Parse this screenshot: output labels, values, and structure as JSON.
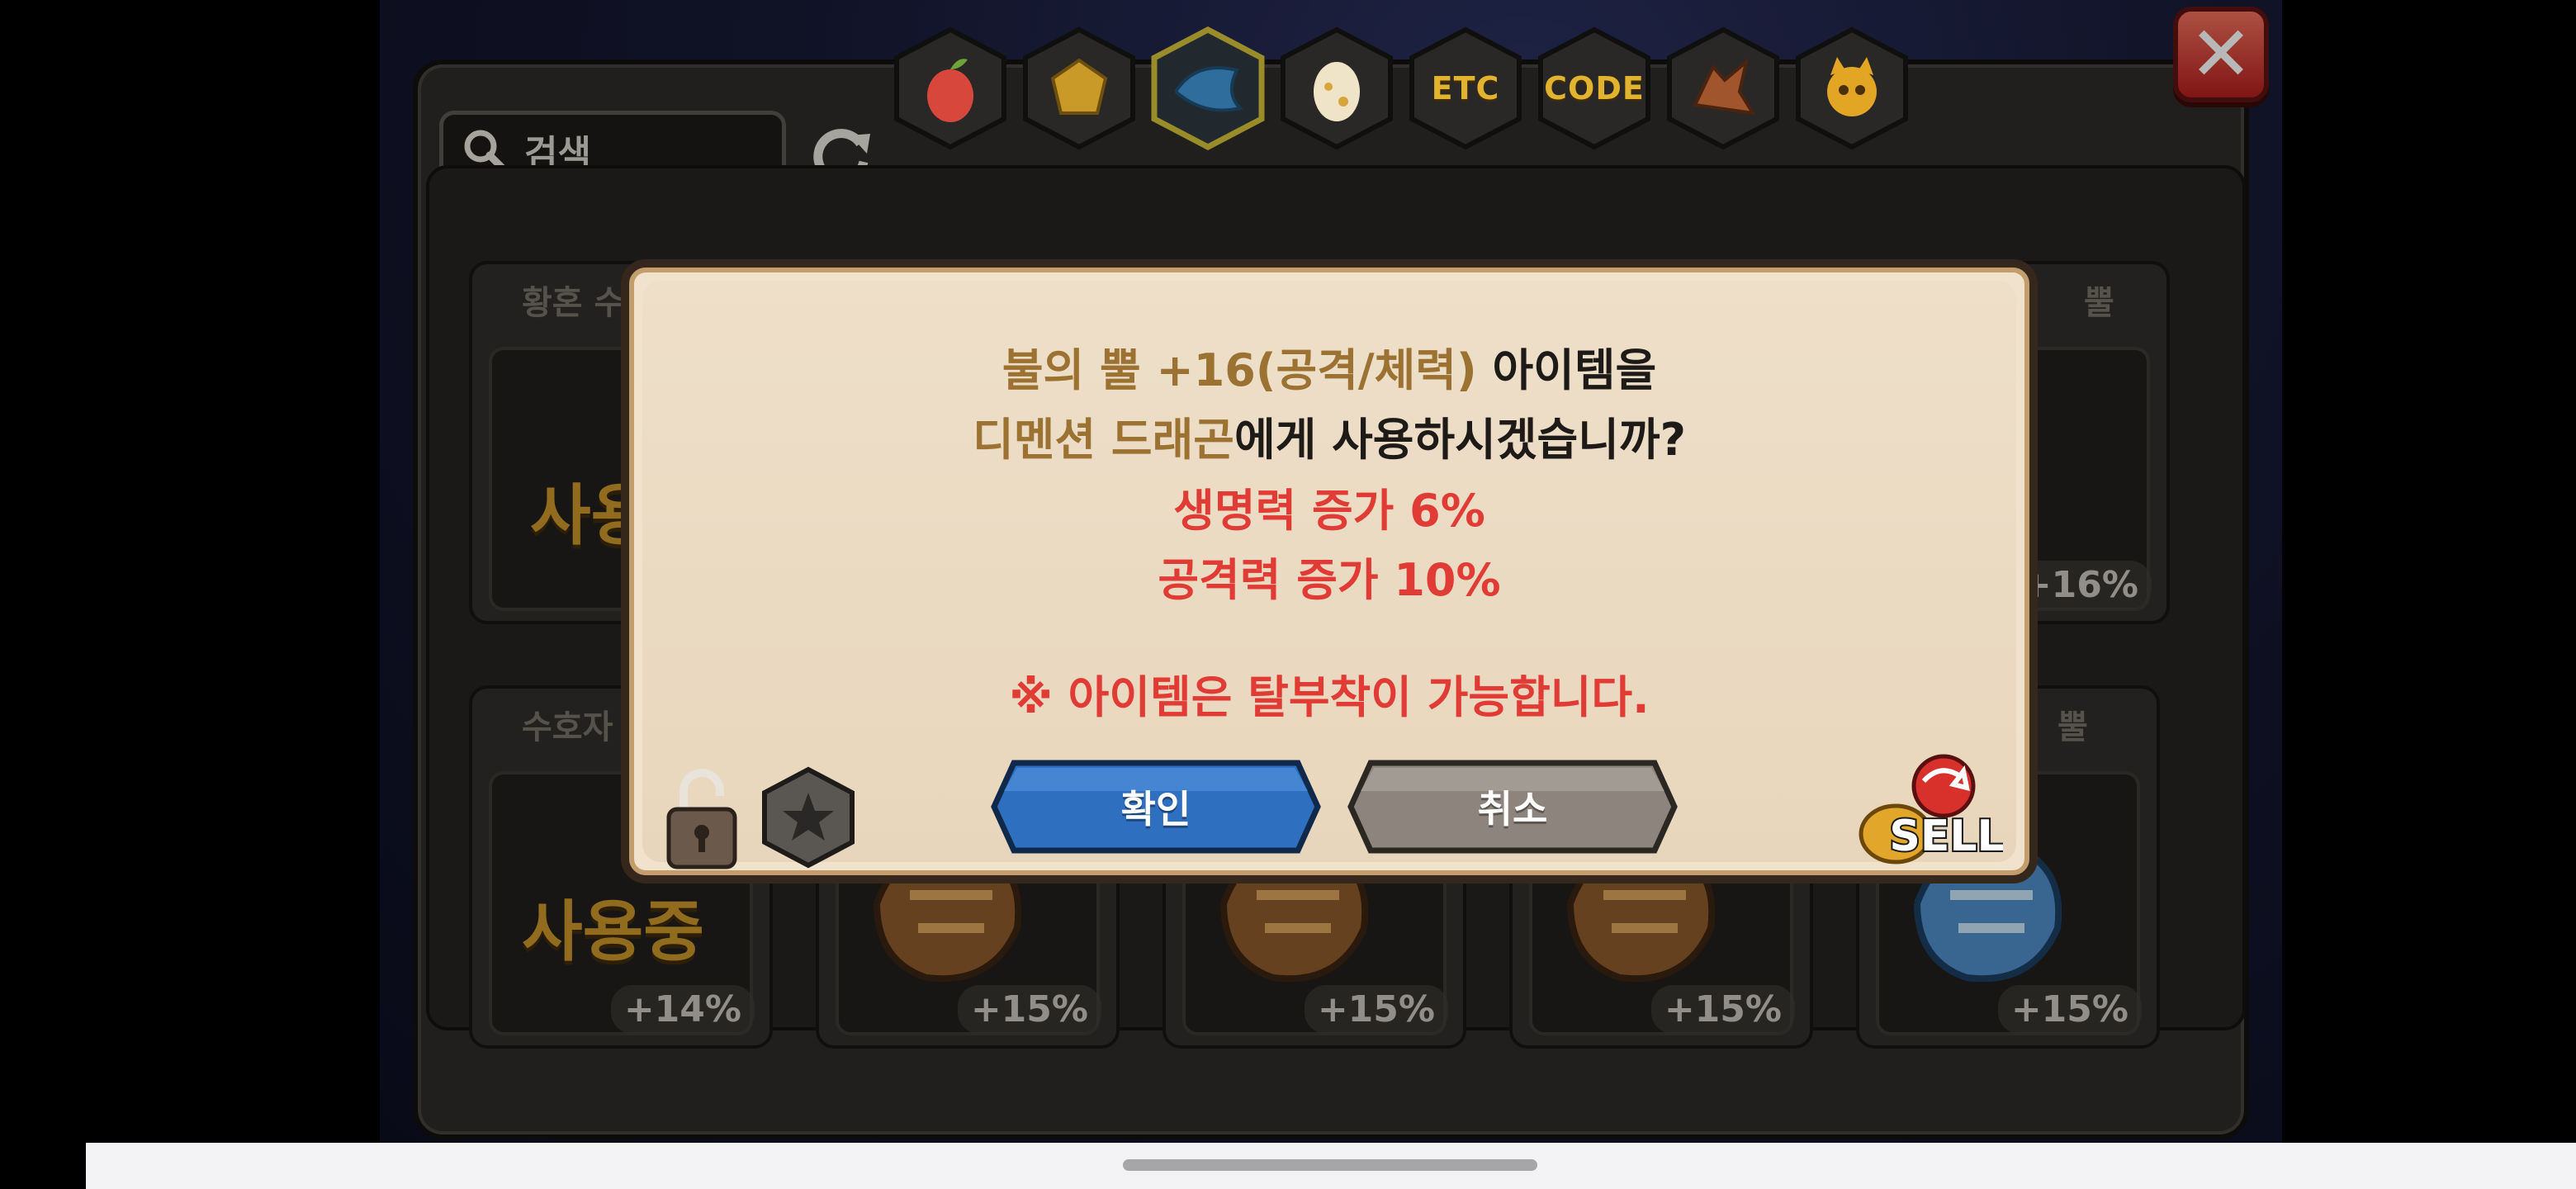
{
  "header": {
    "search_placeholder": "검색",
    "tabs": [
      {
        "name": "tab-fruit",
        "icon": "fruit-icon",
        "label": ""
      },
      {
        "name": "tab-ore",
        "icon": "ore-icon",
        "label": ""
      },
      {
        "name": "tab-scale",
        "icon": "scale-icon",
        "label": "",
        "selected": true
      },
      {
        "name": "tab-egg",
        "icon": "egg-icon",
        "label": ""
      },
      {
        "name": "tab-etc",
        "icon": "",
        "label": "ETC"
      },
      {
        "name": "tab-code",
        "icon": "",
        "label": "CODE"
      },
      {
        "name": "tab-dragon",
        "icon": "dragon-head-icon",
        "label": ""
      },
      {
        "name": "tab-mascot",
        "icon": "mascot-icon",
        "label": ""
      }
    ]
  },
  "inventory": {
    "slots": [
      {
        "name": "황혼 수",
        "bonus": "",
        "in_use": "사용"
      },
      {
        "name": "뿔",
        "bonus": "+16%"
      },
      {
        "name": "수호자",
        "bonus": "+14%",
        "in_use": "사용중"
      },
      {
        "name": "",
        "bonus": "+15%"
      },
      {
        "name": "",
        "bonus": "+15%"
      },
      {
        "name": "",
        "bonus": "+15%"
      },
      {
        "name": "뿔",
        "bonus": "+15%"
      }
    ]
  },
  "dialog": {
    "line1_item": "불의 뿔 +16(공격/체력)",
    "line1_rest": " 아이템을",
    "line2_target": "디멘션 드래곤",
    "line2_rest": "에게 사용하시겠습니까?",
    "stat1": "생명력 증가 6%",
    "stat2": "공격력 증가 10%",
    "note": "※ 아이템은 탈부착이 가능합니다.",
    "confirm_label": "확인",
    "cancel_label": "취소",
    "sell_label": "SELL"
  },
  "colors": {
    "item_text": "#9c7232",
    "warning_text": "#e03b34",
    "confirm_button": "#2f6fbf",
    "cancel_button": "#8d857d"
  }
}
